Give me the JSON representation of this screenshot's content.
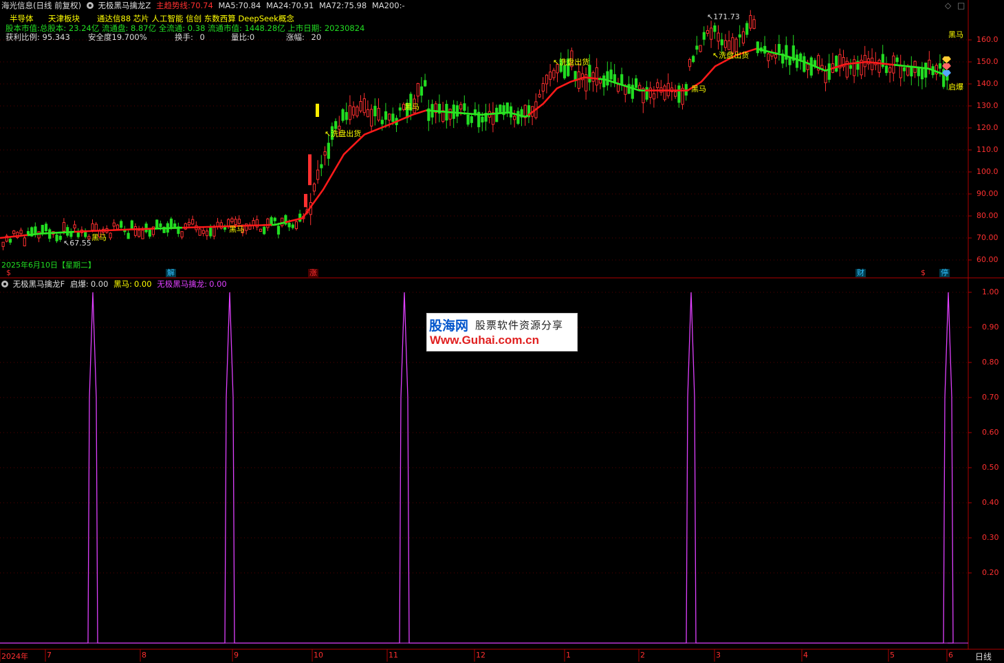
{
  "header": {
    "app_title": "海光信息(日线 前复权)",
    "indicator_name": "无极黑马擒龙Z",
    "main_trend_label": "主趋势线:",
    "main_trend_value": "70.74",
    "ma5_label": "MA5:",
    "ma5_value": "70.84",
    "ma24_label": "MA24:",
    "ma24_value": "70.91",
    "ma72_label": "MA72:",
    "ma72_value": "75.98",
    "ma200_label": "MA200:",
    "ma200_value": "-"
  },
  "info": {
    "industry": "半导体",
    "region_block": "天津板块",
    "concepts": "通达信88 芯片 人工智能 信创 东数西算 DeepSeek概念",
    "capital_line": "股本市值:总股本: 23.24亿 流通盘: 8.87亿 全流通: 0.38 流通市值: 1448.28亿 上市日期: 20230824",
    "profit_ratio_label": "获利比例:",
    "profit_ratio_value": "95.343",
    "safety_label": "安全度19.700%",
    "turnover_label": "换手:",
    "turnover_value": "0",
    "volume_ratio_label": "量比:",
    "volume_ratio_value": "0",
    "change_label": "涨幅:",
    "change_value": "20"
  },
  "main_chart": {
    "date_label": "2025年6月10日【星期二】",
    "y_ticks": [
      "160.0",
      "150.0",
      "140.0",
      "130.0",
      "120.0",
      "110.0",
      "100.0",
      "90.00",
      "80.00",
      "70.00",
      "60.00"
    ],
    "annotations": {
      "high_label": "171.73",
      "low_label": "67.55",
      "heima": "黑马",
      "xipan": "洗盘出货",
      "qibao": "启爆"
    },
    "event_tags": [
      {
        "text": "$",
        "color": "#ff3030"
      },
      {
        "text": "解",
        "color": "#30c0ff"
      },
      {
        "text": "涨",
        "color": "#ff3030"
      },
      {
        "text": "财",
        "color": "#30c0ff"
      },
      {
        "text": "$",
        "color": "#ff3030"
      },
      {
        "text": "停",
        "color": "#30c0ff"
      }
    ]
  },
  "sub_chart": {
    "indicator_name": "无极黑马擒龙F",
    "qibao_label": "启爆:",
    "qibao_value": "0.00",
    "heima_label": "黑马:",
    "heima_value": "0.00",
    "wuji_label": "无极黑马擒龙:",
    "wuji_value": "0.00",
    "y_ticks": [
      "1.00",
      "0.90",
      "0.80",
      "0.70",
      "0.60",
      "0.50",
      "0.40",
      "0.30",
      "0.20"
    ]
  },
  "x_axis": {
    "labels": [
      "2024年",
      "7",
      "8",
      "9",
      "10",
      "11",
      "12",
      "1",
      "2",
      "3",
      "4",
      "5",
      "6"
    ],
    "period": "日线"
  },
  "watermark": {
    "brand": "股海网",
    "slogan": "股票软件资源分享",
    "url": "Www.Guhai.com.cn"
  },
  "colors": {
    "up": "#ff3030",
    "down": "#22dd22",
    "axis": "#b00000",
    "trend_up": "#ff1a1a",
    "trend_down": "#22ee22",
    "signal": "#e040ff",
    "label_yellow": "#ffff00",
    "label_green": "#22ee22"
  }
}
